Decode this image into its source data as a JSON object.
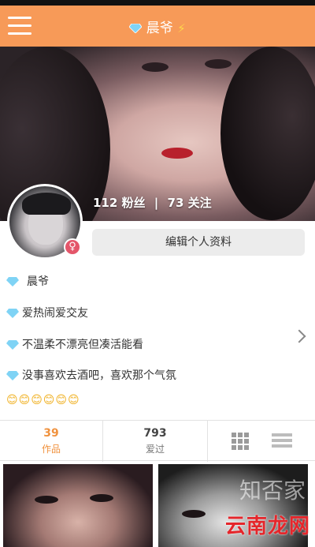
{
  "header": {
    "title": "晨爷",
    "menu_icon": "hamburger-icon",
    "verified_icon": "diamond-icon",
    "bolt_icon": "lightning-icon"
  },
  "profile": {
    "followers_count": "112",
    "followers_label": "粉丝",
    "separator": "|",
    "following_count": "73",
    "following_label": "关注",
    "gender_symbol": "♀",
    "edit_button": "编辑个人资料"
  },
  "bio": {
    "name": "晨爷",
    "line1": "爱热闹爱交友",
    "line2": "不温柔不漂亮但凑活能看",
    "line3": "没事喜欢去酒吧，喜欢那个气氛",
    "emojis": "😊😊😊😊😊😊"
  },
  "tabs": [
    {
      "count": "39",
      "label": "作品"
    },
    {
      "count": "793",
      "label": "爱过"
    }
  ],
  "view_toggle": {
    "grid_icon": "grid-icon",
    "list_icon": "list-icon"
  },
  "watermark": {
    "main": "云南龙网",
    "faint": "知否家"
  },
  "colors": {
    "accent": "#f79a58",
    "active_tab": "#f0923e",
    "gender": "#e4566a"
  }
}
